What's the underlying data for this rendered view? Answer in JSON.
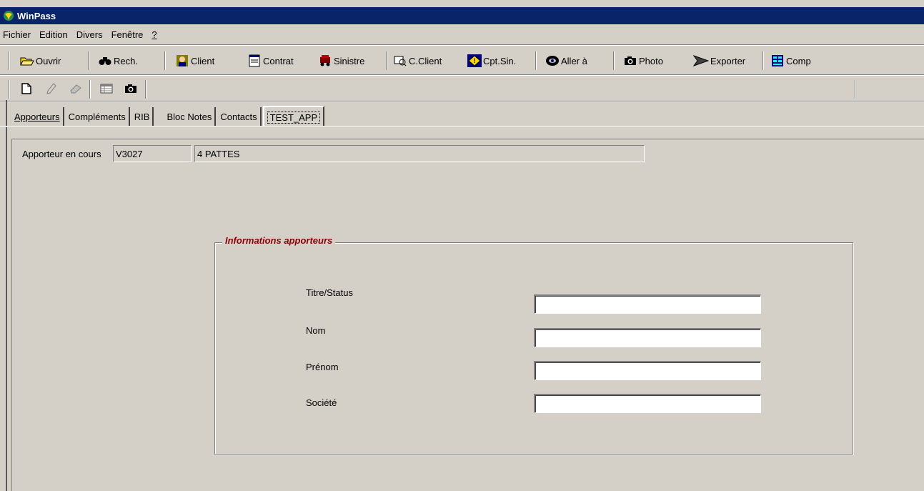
{
  "window": {
    "title": "WinPass"
  },
  "menu": [
    {
      "label": "Fichier"
    },
    {
      "label": "Edition"
    },
    {
      "label": "Divers"
    },
    {
      "label": "Fenêtre"
    },
    {
      "label": "?"
    }
  ],
  "toolbar": {
    "ouvrir": "Ouvrir",
    "rech": "Rech.",
    "client": "Client",
    "contrat": "Contrat",
    "sinistre": "Sinistre",
    "cclient": "C.Client",
    "cptsin": "Cpt.Sin.",
    "aller": "Aller à",
    "photo": "Photo",
    "exporter": "Exporter",
    "comp": "Comp"
  },
  "tabs": [
    {
      "label": "Apporteurs"
    },
    {
      "label": "Compléments"
    },
    {
      "label": "RIB"
    },
    {
      "label": "Bloc Notes"
    },
    {
      "label": "Contacts"
    },
    {
      "label": "TEST_APP"
    }
  ],
  "current": {
    "label": "Apporteur en cours",
    "code": "V3027",
    "name": "4 PATTES"
  },
  "group": {
    "title": "Informations apporteurs",
    "fields": [
      {
        "label": "Titre/Status",
        "value": ""
      },
      {
        "label": "Nom",
        "value": ""
      },
      {
        "label": "Prénom",
        "value": ""
      },
      {
        "label": "Société",
        "value": ""
      }
    ]
  },
  "colors": {
    "titlebar": "#0a246a",
    "legend": "#8b0000",
    "face": "#d4d0c8"
  }
}
